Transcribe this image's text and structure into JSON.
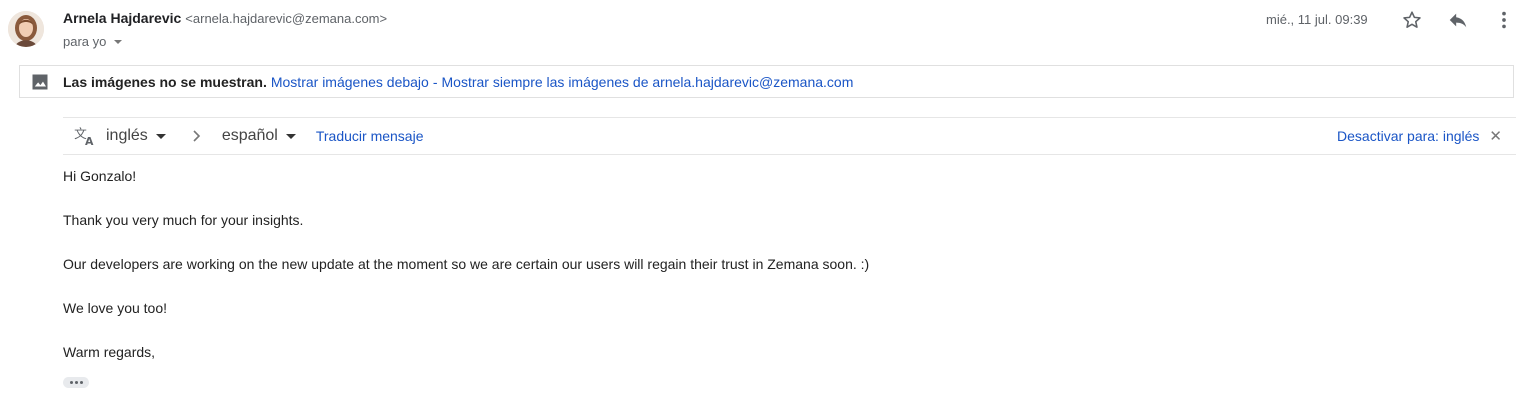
{
  "header": {
    "sender_name": "Arnela Hajdarevic",
    "sender_email": "<arnela.hajdarevic@zemana.com>",
    "recipient": "para yo",
    "date": "mié., 11 jul. 09:39",
    "icons": [
      "star-icon",
      "reply-icon",
      "more-vert-icon",
      "chevron-down-icon"
    ]
  },
  "images_notice": {
    "icon": "image-icon",
    "bold_text": "Las imágenes no se muestran.",
    "show_below": "Mostrar imágenes debajo",
    "separator": "-",
    "always_show": "Mostrar siempre las imágenes de arnela.hajdarevic@zemana.com"
  },
  "translate_bar": {
    "icon": "translate-icon",
    "source_lang": "inglés",
    "target_lang": "español",
    "translate_label": "Traducir mensaje",
    "deactivate_label": "Desactivar para: inglés",
    "close_glyph": "✕"
  },
  "message": {
    "lines": [
      "Hi Gonzalo!",
      "Thank you very much for your insights.",
      "Our developers are working on the new update at the moment so we are certain our users will regain their trust in Zemana soon. :)",
      "We love you too!",
      "Warm regards,"
    ]
  },
  "colors": {
    "link": "#1a55c6",
    "text": "#222222",
    "muted": "#5f6368"
  }
}
